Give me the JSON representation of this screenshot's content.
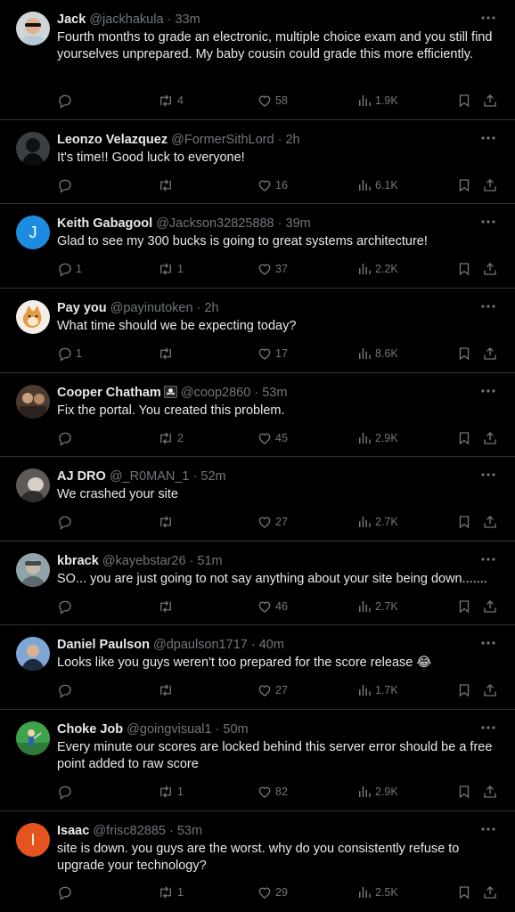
{
  "colors": {
    "background": "#000000",
    "text": "#e7e9ea",
    "muted": "#71767b",
    "divider": "#2f3336"
  },
  "tweets": [
    {
      "name": "Jack",
      "handle": "@jackhakula",
      "sep": "·",
      "time": "33m",
      "text": "Fourth months to grade an electronic, multiple choice exam and you still find yourselves unprepared. My baby cousin could grade this more efficiently.",
      "replies": "",
      "retweets": "4",
      "likes": "58",
      "views": "1.9K"
    },
    {
      "name": "Leonzo Velazquez",
      "handle": "@FormerSithLord",
      "sep": "·",
      "time": "2h",
      "text": "It's time!! Good luck to everyone!",
      "replies": "",
      "retweets": "",
      "likes": "16",
      "views": "6.1K"
    },
    {
      "name": "Keith Gabagool",
      "handle": "@Jackson32825888",
      "sep": "·",
      "time": "39m",
      "text": "Glad to see my 300 bucks is going to great systems architecture!",
      "replies": "1",
      "retweets": "1",
      "likes": "37",
      "views": "2.2K",
      "avatar_letter": "J"
    },
    {
      "name": "Pay you",
      "handle": "@payinutoken",
      "sep": "·",
      "time": "2h",
      "text": "What time should we be expecting today?",
      "replies": "1",
      "retweets": "",
      "likes": "17",
      "views": "8.6K"
    },
    {
      "name": "Cooper Chatham",
      "handle": "@coop2860",
      "sep": "·",
      "time": "53m",
      "text": "Fix the portal. You created this problem.",
      "replies": "",
      "retweets": "2",
      "likes": "45",
      "views": "2.9K",
      "badge_icon": "pirate-flag-icon"
    },
    {
      "name": "AJ DRO",
      "handle": "@_R0MAN_1",
      "sep": "·",
      "time": "52m",
      "text": "We crashed your site",
      "replies": "",
      "retweets": "",
      "likes": "27",
      "views": "2.7K"
    },
    {
      "name": "kbrack",
      "handle": "@kayebstar26",
      "sep": "·",
      "time": "51m",
      "text": "SO... you are just going to not say anything about your site being down.......",
      "replies": "",
      "retweets": "",
      "likes": "46",
      "views": "2.7K"
    },
    {
      "name": "Daniel Paulson",
      "handle": "@dpaulson1717",
      "sep": "·",
      "time": "40m",
      "text": "Looks like you guys weren't too prepared for the score release 😂",
      "replies": "",
      "retweets": "",
      "likes": "27",
      "views": "1.7K"
    },
    {
      "name": "Choke Job",
      "handle": "@goingvisual1",
      "sep": "·",
      "time": "50m",
      "text": "Every minute our scores are locked behind this server error should be a free point added to raw score",
      "replies": "",
      "retweets": "1",
      "likes": "82",
      "views": "2.9K"
    },
    {
      "name": "Isaac",
      "handle": "@frisc82885",
      "sep": "·",
      "time": "53m",
      "text": "site is down. you guys are the worst. why do you consistently refuse to upgrade your technology?",
      "replies": "",
      "retweets": "1",
      "likes": "29",
      "views": "2.5K",
      "avatar_letter": "I"
    }
  ]
}
